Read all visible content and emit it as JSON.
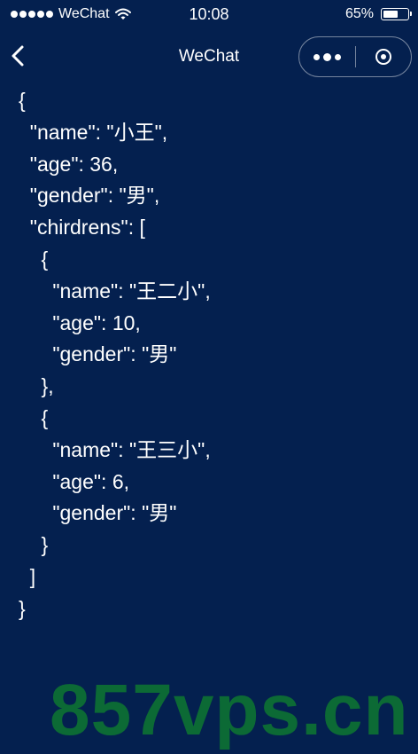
{
  "status_bar": {
    "carrier": "WeChat",
    "time": "10:08",
    "battery_percent": "65%",
    "battery_level": 0.65,
    "signal_icon": "signal-dots-icon",
    "wifi_icon": "wifi-icon",
    "battery_icon": "battery-icon"
  },
  "nav": {
    "title": "WeChat",
    "back_icon": "chevron-left-icon",
    "more_icon": "more-dots-icon",
    "close_icon": "target-circle-icon"
  },
  "json_lines": [
    "{",
    "  \"name\": \"小王\",",
    "  \"age\": 36,",
    "  \"gender\": \"男\",",
    "  \"chirdrens\": [",
    "    {",
    "      \"name\": \"王二小\",",
    "      \"age\": 10,",
    "      \"gender\": \"男\"",
    "    },",
    "    {",
    "      \"name\": \"王三小\",",
    "      \"age\": 6,",
    "      \"gender\": \"男\"",
    "    }",
    "  ]",
    "}"
  ],
  "watermark": "857vps.cn",
  "colors": {
    "background": "#04204f",
    "text": "#ffffff",
    "watermark": "#0c6a35"
  }
}
